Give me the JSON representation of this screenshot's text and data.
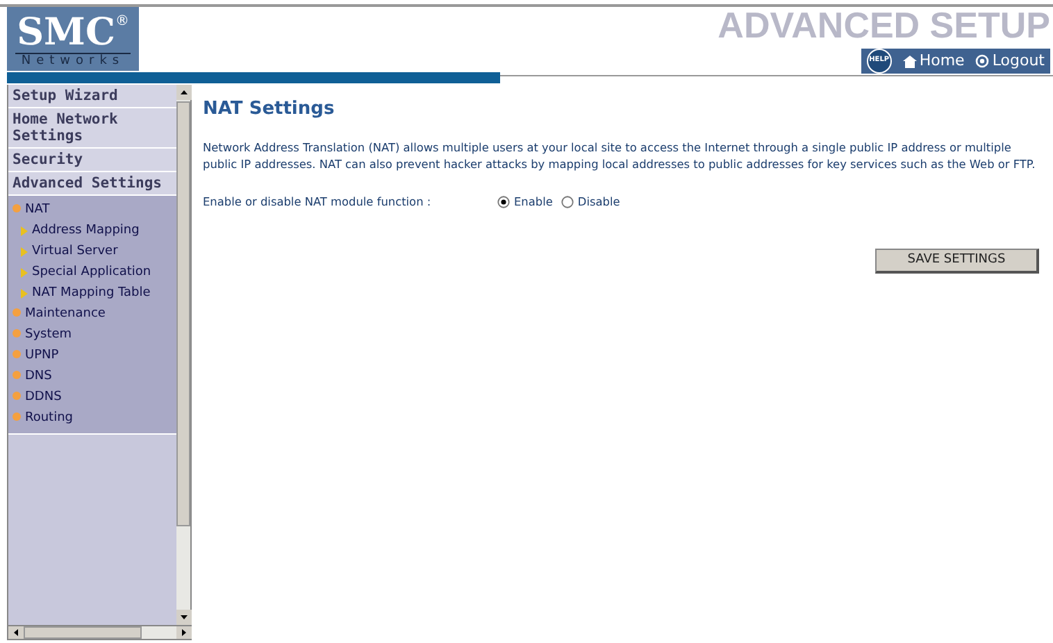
{
  "header": {
    "logo": "SMC",
    "logo_mark": "®",
    "logo_sub": "Networks",
    "banner": "ADVANCED SETUP",
    "help": "HELP",
    "links": [
      "Home",
      "Logout"
    ]
  },
  "sidebar": {
    "sections": [
      "Setup Wizard",
      "Home Network Settings",
      "Security",
      "Advanced Settings"
    ],
    "items": [
      {
        "label": "NAT",
        "children": [
          {
            "label": "Address Mapping"
          },
          {
            "label": "Virtual Server"
          },
          {
            "label": "Special Application"
          },
          {
            "label": "NAT Mapping Table"
          }
        ]
      },
      {
        "label": "Maintenance"
      },
      {
        "label": "System"
      },
      {
        "label": "UPNP"
      },
      {
        "label": "DNS"
      },
      {
        "label": "DDNS"
      },
      {
        "label": "Routing"
      }
    ]
  },
  "content": {
    "title": "NAT Settings",
    "description": "Network Address Translation (NAT) allows multiple users at your local site to access the Internet through a single public IP address or multiple public IP addresses. NAT can also prevent hacker attacks by mapping local addresses to public addresses for key services such as the Web or FTP.",
    "nat_label": "Enable or disable NAT module function :",
    "options": [
      {
        "label": "Enable",
        "selected": true
      },
      {
        "label": "Disable",
        "selected": false
      }
    ],
    "save_button": "SAVE SETTINGS"
  }
}
